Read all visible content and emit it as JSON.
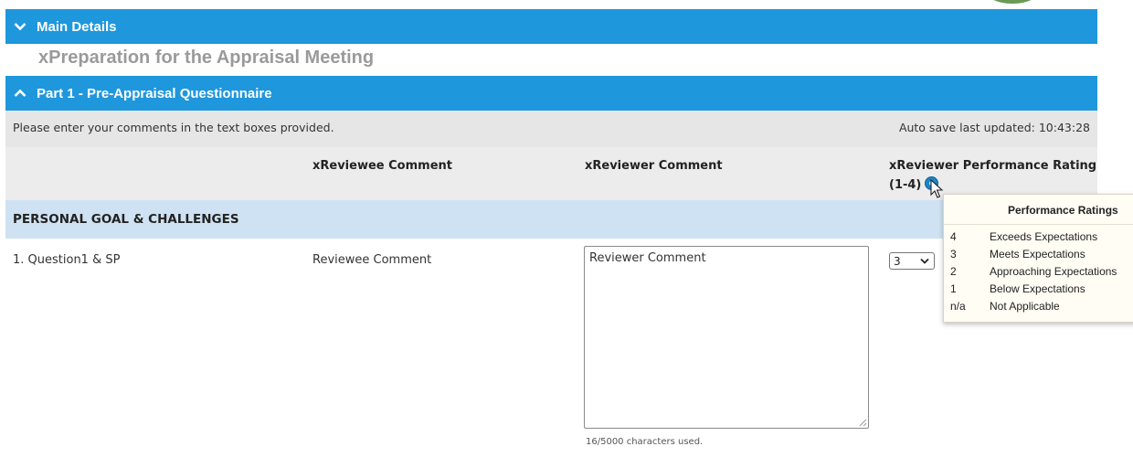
{
  "main_details": {
    "label": "Main Details"
  },
  "preparation_title": "xPreparation for the Appraisal Meeting",
  "part1": {
    "label": "Part 1 - Pre-Appraisal Questionnaire"
  },
  "info": {
    "instructions": "Please enter your comments in the text boxes provided.",
    "autosave": "Auto save last updated: 10:43:28"
  },
  "columns": {
    "reviewee": "xReviewee Comment",
    "reviewer": "xReviewer Comment",
    "rating": "xReviewer Performance Rating (1-4)"
  },
  "category": "PERSONAL GOAL & CHALLENGES",
  "question": {
    "label": "1. Question1 & SP",
    "reviewee_comment": "Reviewee Comment",
    "reviewer_comment": "Reviewer Comment",
    "char_count": "16/5000 characters used.",
    "rating_value": "3"
  },
  "tooltip": {
    "title": "Performance Ratings",
    "items": [
      {
        "code": "4",
        "desc": "Exceeds Expectations"
      },
      {
        "code": "3",
        "desc": "Meets Expectations"
      },
      {
        "code": "2",
        "desc": "Approaching Expectations"
      },
      {
        "code": "1",
        "desc": "Below Expectations"
      },
      {
        "code": "n/a",
        "desc": "Not Applicable"
      }
    ]
  },
  "colors": {
    "section_bar": "#1f97dd",
    "info_row": "#e6e6e6",
    "category_row": "#cfe2f3"
  }
}
